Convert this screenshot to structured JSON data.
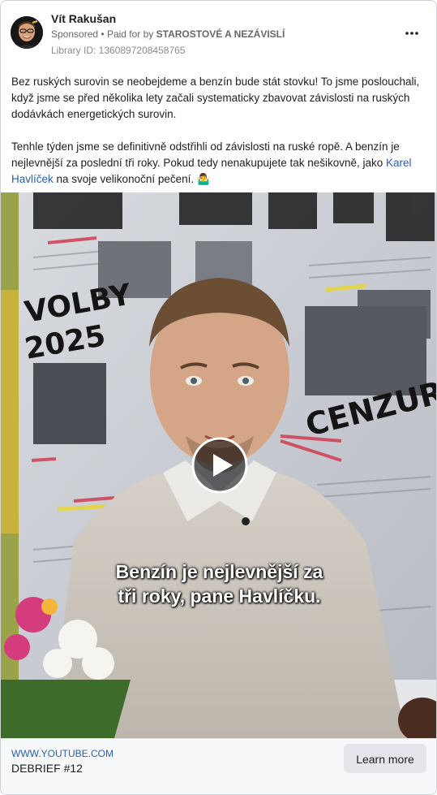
{
  "post": {
    "author": "Vít Rakušan",
    "sponsored_label": "Sponsored",
    "paid_for_prefix": "Paid for by",
    "payer": "STAROSTOVÉ A NEZÁVISLÍ",
    "library_id": "Library ID: 1360897208458765",
    "more_icon": "more-horizontal-icon",
    "text": {
      "p1": "Bez ruských surovin se neobejdeme a benzín bude stát stovku! To jsme poslouchali, když jsme se před několika lety začali systematicky zbavovat závislosti na ruských dodávkách energetických surovin.",
      "p2_start": "Tenhle týden jsme se definitivně odstřihli od závislosti na ruské ropě. A benzín je nejlevnější za poslední tři roky. Pokud tedy nenakupujete tak nešikovně, jako ",
      "p2_link": "Karel Havlíček",
      "p2_end": " na svoje velikonoční pečení.",
      "emoji": "🤷‍♂️"
    }
  },
  "video": {
    "poster_texts": {
      "volby": "VOLBY",
      "year": "2025",
      "cenzura": "CENZURA?"
    },
    "subtitle_line1": "Benzín je nejlevnější za",
    "subtitle_line2": "tři roky, pane Havlíčku.",
    "play_icon": "play-icon"
  },
  "link_preview": {
    "domain": "WWW.YOUTUBE.COM",
    "headline": "DEBRIEF #12",
    "cta": "Learn more"
  },
  "colors": {
    "link": "#2a5fb0",
    "secondary_text": "#65676b",
    "footer_bg": "#f7f8fa",
    "button_bg": "#e4e6eb"
  }
}
